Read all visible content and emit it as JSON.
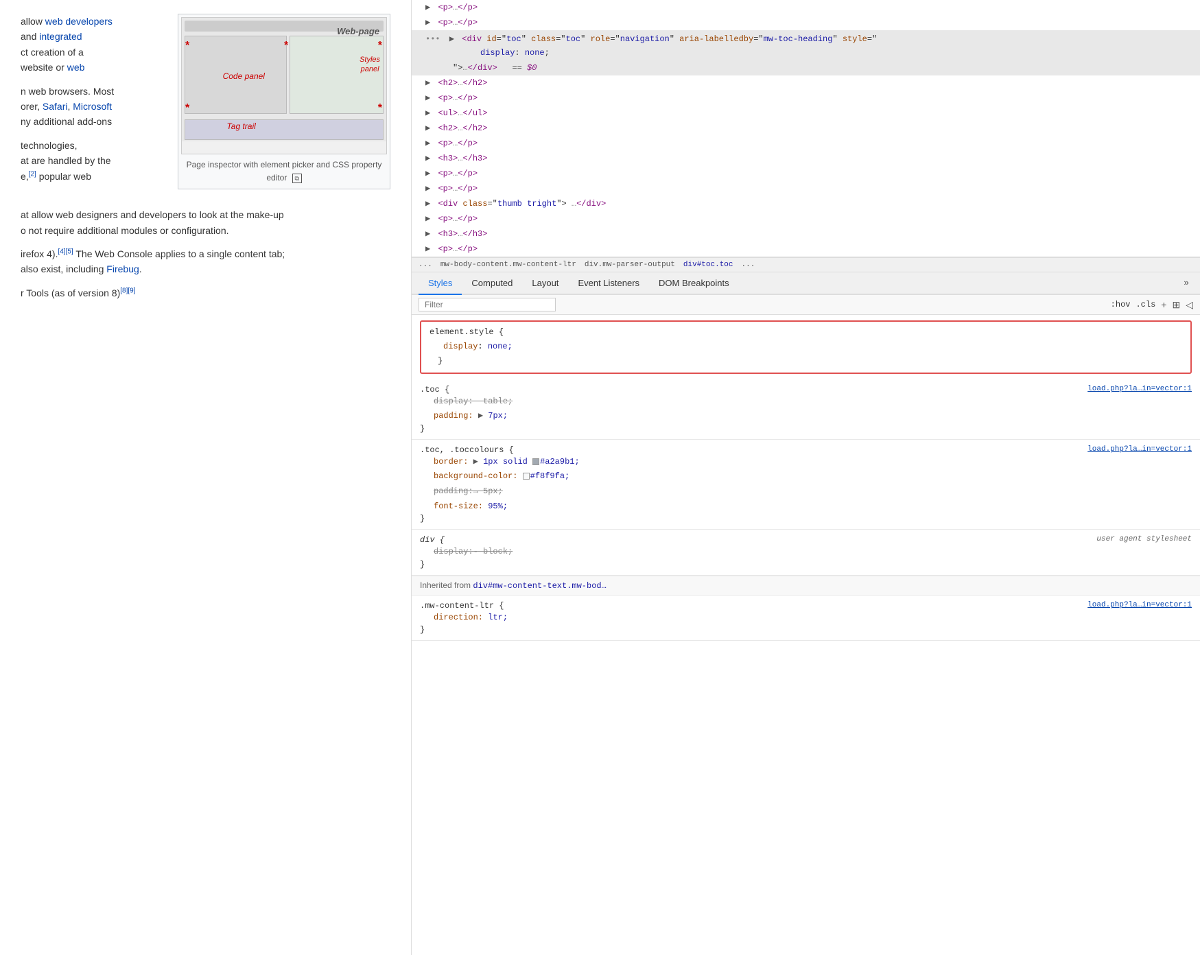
{
  "left": {
    "paragraphs": [
      "allow web developers and integrated ct creation of a website or web",
      "n web browsers. Most orer, Safari, Microsoft ny additional add-ons",
      "technologies, at are handled by the e,[2] popular web",
      "at allow web designers and developers to look at the make-up o not require additional modules or configuration.",
      "irefox 4).[4][5] The Web Console applies to a single content tab; also exist, including Firebug.",
      "r Tools (as of version 8)[8][9]"
    ],
    "links": [
      "web developers",
      "integrated",
      "website or web",
      "web browsers",
      "Safari",
      "Microsoft",
      "Firebug"
    ],
    "image_caption": "Page inspector with element picker and CSS property editor",
    "image_expand_icon": "⧉",
    "labels": {
      "code_panel": "Code panel",
      "styles_panel": "Styles panel",
      "tag_trail": "Tag trail"
    }
  },
  "devtools": {
    "html_lines": [
      {
        "indent": 1,
        "content": "▶ <p>…</p>",
        "id": "p1"
      },
      {
        "indent": 1,
        "content": "▶ <p>…</p>",
        "id": "p2"
      },
      {
        "indent": 1,
        "content": "▶ <div id=\"toc\" class=\"toc\" role=\"navigation\" aria-labelledby=\"mw-toc-heading\" style=\"",
        "id": "div-toc",
        "highlighted": true
      },
      {
        "indent": 2,
        "content": "display: none;",
        "id": "display-none"
      },
      {
        "indent": 2,
        "content": "\">…</div>  ==  $0",
        "id": "div-end"
      },
      {
        "indent": 1,
        "content": "▶ <h2>…</h2>",
        "id": "h2-1"
      },
      {
        "indent": 1,
        "content": "▶ <p>…</p>",
        "id": "p3"
      },
      {
        "indent": 1,
        "content": "▶ <ul>…</ul>",
        "id": "ul1"
      },
      {
        "indent": 1,
        "content": "▶ <h2>…</h2>",
        "id": "h2-2"
      },
      {
        "indent": 1,
        "content": "▶ <p>…</p>",
        "id": "p4"
      },
      {
        "indent": 1,
        "content": "▶ <h3>…</h3>",
        "id": "h3-1"
      },
      {
        "indent": 1,
        "content": "▶ <p>…</p>",
        "id": "p5"
      },
      {
        "indent": 1,
        "content": "▶ <p>…</p>",
        "id": "p6"
      },
      {
        "indent": 1,
        "content": "▶ <div class=\"thumb tright\">…</div>",
        "id": "div-thumb"
      },
      {
        "indent": 1,
        "content": "▶ <p>…</p>",
        "id": "p7"
      },
      {
        "indent": 1,
        "content": "▶ <h3>…</h3>",
        "id": "h3-2"
      },
      {
        "indent": 1,
        "content": "▶ <p>…</p>",
        "id": "p8"
      }
    ],
    "breadcrumb": {
      "items": [
        "...",
        "mw-body-content.mw-content-ltr",
        "div.mw-parser-output",
        "div#toc.toc",
        "..."
      ]
    },
    "tabs": [
      "Styles",
      "Computed",
      "Layout",
      "Event Listeners",
      "DOM Breakpoints"
    ],
    "active_tab": "Styles",
    "filter_placeholder": "Filter",
    "toolbar_actions": [
      ":hov",
      ".cls",
      "+",
      "copy-icon",
      "back-icon"
    ],
    "css_rules": [
      {
        "id": "element-style",
        "selector": "element.style {",
        "source": "",
        "highlighted": true,
        "properties": [
          {
            "name": "display",
            "value": "none;",
            "strikethrough": false
          }
        ]
      },
      {
        "id": "toc-rule",
        "selector": ".toc {",
        "source": "load.php?la…in=vector:1",
        "properties": [
          {
            "name": "display:- table;",
            "value": "",
            "strikethrough": true
          },
          {
            "name": "padding:",
            "value": "▶ 7px;",
            "strikethrough": false
          }
        ]
      },
      {
        "id": "toc-toccolours",
        "selector": ".toc, .toccolours {",
        "source": "load.php?la…in=vector:1",
        "properties": [
          {
            "name": "border:",
            "value": "▶ 1px solid ■#a2a9b1;",
            "strikethrough": false
          },
          {
            "name": "background-color:",
            "value": "□#f8f9fa;",
            "strikethrough": false
          },
          {
            "name": "padding:→ 5px;",
            "value": "",
            "strikethrough": true
          },
          {
            "name": "font-size:",
            "value": "95%;",
            "strikethrough": false
          }
        ]
      },
      {
        "id": "div-rule",
        "selector": "div {",
        "source": "user agent stylesheet",
        "properties": [
          {
            "name": "display:- block;",
            "value": "",
            "strikethrough": true
          }
        ]
      },
      {
        "id": "inherited-label",
        "text": "Inherited from div#mw-content-text.mw-bod…"
      },
      {
        "id": "mw-content-ltr",
        "selector": ".mw-content-ltr {",
        "source": "load.php?la…in=vector:1",
        "properties": [
          {
            "name": "direction:",
            "value": "ltr;",
            "strikethrough": false
          }
        ]
      }
    ]
  }
}
